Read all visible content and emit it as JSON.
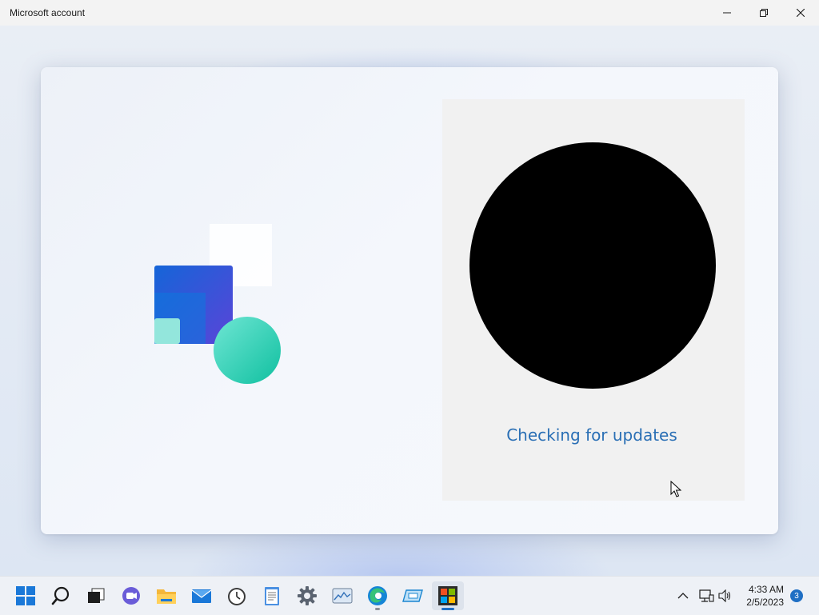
{
  "window": {
    "title": "Microsoft account",
    "controls": [
      "minimize",
      "restore",
      "close"
    ]
  },
  "content": {
    "status_text": "Checking for updates"
  },
  "taskbar": {
    "icons": [
      {
        "name": "start",
        "icon": "windows-logo-icon"
      },
      {
        "name": "search",
        "icon": "search-icon"
      },
      {
        "name": "task-view",
        "icon": "task-view-icon"
      },
      {
        "name": "chat",
        "icon": "chat-icon"
      },
      {
        "name": "file-explorer",
        "icon": "folder-icon"
      },
      {
        "name": "mail",
        "icon": "mail-icon"
      },
      {
        "name": "clock",
        "icon": "clock-icon"
      },
      {
        "name": "notepad",
        "icon": "notepad-icon"
      },
      {
        "name": "settings",
        "icon": "gear-icon"
      },
      {
        "name": "photos",
        "icon": "photos-icon"
      },
      {
        "name": "edge",
        "icon": "edge-icon"
      },
      {
        "name": "app",
        "icon": "app-icon"
      },
      {
        "name": "microsoft-store",
        "icon": "store-icon",
        "active": true
      }
    ],
    "tray": {
      "time": "4:33 AM",
      "date": "2/5/2023",
      "notification_count": "3"
    }
  },
  "colors": {
    "accent": "#1f6fc4",
    "status_text": "#2a6fb5",
    "avatar": "#000000"
  }
}
